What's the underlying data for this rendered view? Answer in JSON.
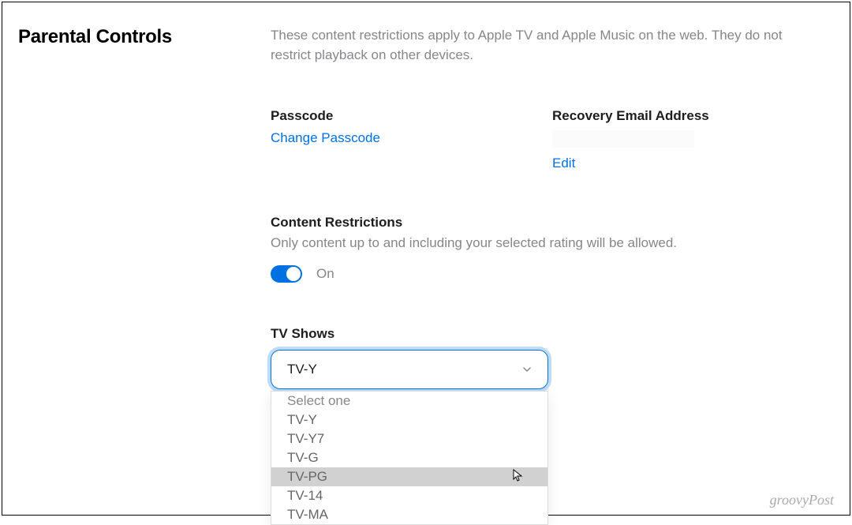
{
  "page": {
    "title": "Parental Controls",
    "description": "These content restrictions apply to Apple TV and Apple Music on the web. They do not restrict playback on other devices."
  },
  "passcode": {
    "label": "Passcode",
    "change_link": "Change Passcode"
  },
  "recovery": {
    "label": "Recovery Email Address",
    "edit_link": "Edit"
  },
  "content_restrictions": {
    "label": "Content Restrictions",
    "sub": "Only content up to and including your selected rating will be allowed.",
    "toggle_state": "On"
  },
  "tv_shows": {
    "label": "TV Shows",
    "selected": "TV-Y",
    "options": {
      "placeholder": "Select one",
      "o1": "TV-Y",
      "o2": "TV-Y7",
      "o3": "TV-G",
      "o4": "TV-PG",
      "o5": "TV-14",
      "o6": "TV-MA"
    }
  },
  "watermark": "groovyPost"
}
